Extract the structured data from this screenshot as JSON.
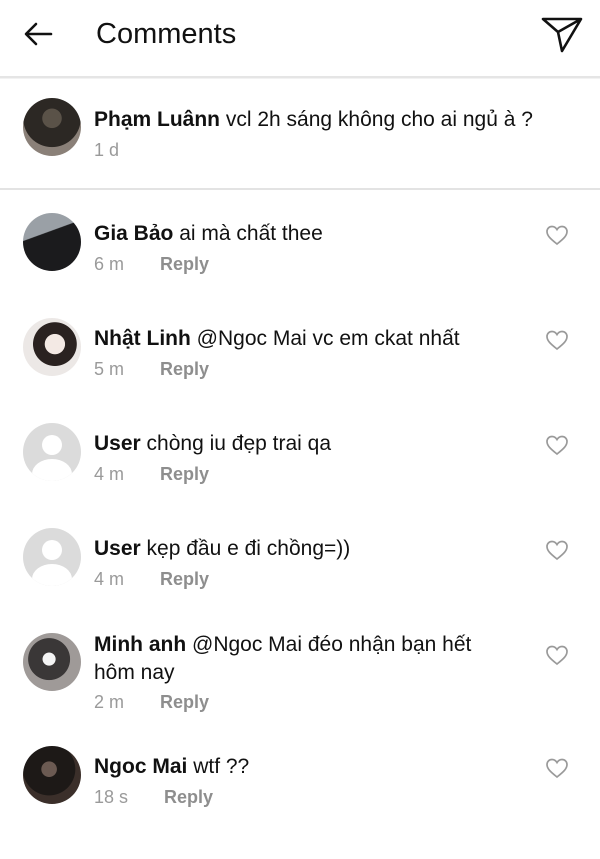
{
  "header": {
    "title": "Comments",
    "back_icon": "arrow-left-icon",
    "share_icon": "paper-plane-icon"
  },
  "caption": {
    "username": "Phạm Luânn",
    "text": "vcl 2h sáng không cho ai ngủ à ?",
    "time": "1 d"
  },
  "comments": [
    {
      "username": "Gia Bảo",
      "text": "ai mà chất thee",
      "time": "6 m",
      "reply": "Reply"
    },
    {
      "username": "Nhật Linh",
      "text": "@Ngoc Mai vc em ckat nhất",
      "time": "5 m",
      "reply": "Reply"
    },
    {
      "username": "User",
      "text": "chòng iu đẹp trai qa",
      "time": "4 m",
      "reply": "Reply"
    },
    {
      "username": "User",
      "text": "kẹp đầu e đi chồng=))",
      "time": "4 m",
      "reply": "Reply"
    },
    {
      "username": "Minh anh",
      "text": "@Ngoc Mai đéo nhận bạn hết hôm nay",
      "time": "2 m",
      "reply": "Reply"
    },
    {
      "username": "Ngoc Mai",
      "text": "wtf ??",
      "time": "18 s",
      "reply": "Reply"
    }
  ],
  "colors": {
    "text": "#111111",
    "meta": "#9a9a9a",
    "default_avatar": "#dbdbdb"
  }
}
